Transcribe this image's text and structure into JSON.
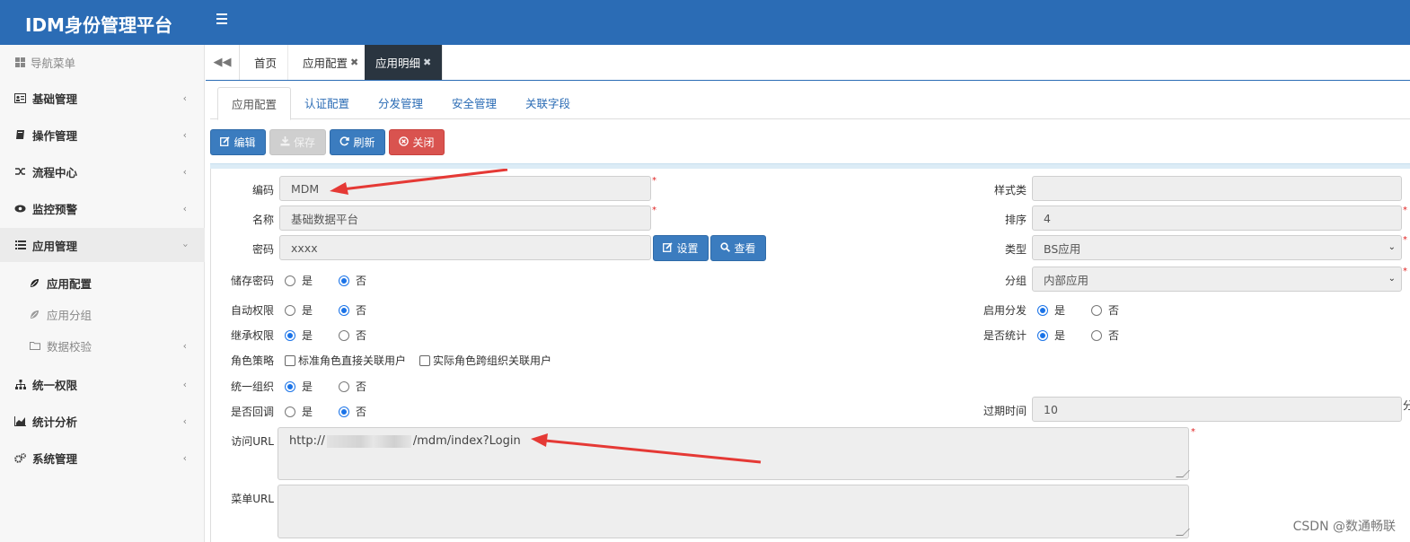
{
  "app": {
    "title": "IDM身份管理平台"
  },
  "sidebar": {
    "header": "导航菜单",
    "items": [
      {
        "label": "基础管理",
        "icon": "id-card-icon"
      },
      {
        "label": "操作管理",
        "icon": "book-icon"
      },
      {
        "label": "流程中心",
        "icon": "shuffle-icon"
      },
      {
        "label": "监控预警",
        "icon": "eye-icon"
      },
      {
        "label": "应用管理",
        "icon": "list-icon"
      },
      {
        "label": "统一权限",
        "icon": "sitemap-icon"
      },
      {
        "label": "统计分析",
        "icon": "area-chart-icon"
      },
      {
        "label": "系统管理",
        "icon": "cogs-icon"
      }
    ],
    "sub_items": [
      {
        "label": "应用配置",
        "icon": "leaf-icon"
      },
      {
        "label": "应用分组",
        "icon": "leaf-icon"
      },
      {
        "label": "数据校验",
        "icon": "folder-icon"
      }
    ]
  },
  "tabs": [
    {
      "label": "首页"
    },
    {
      "label": "应用配置"
    },
    {
      "label": "应用明细"
    }
  ],
  "subtabs": [
    "应用配置",
    "认证配置",
    "分发管理",
    "安全管理",
    "关联字段"
  ],
  "toolbar": {
    "edit": "编辑",
    "save": "保存",
    "refresh": "刷新",
    "close": "关闭"
  },
  "form": {
    "code_label": "编码",
    "code_value": "MDM",
    "name_label": "名称",
    "name_value": "基础数据平台",
    "password_label": "密码",
    "password_value": "xxxx",
    "set_button": "设置",
    "view_button": "查看",
    "store_pwd_label": "储存密码",
    "auto_perm_label": "自动权限",
    "inherit_perm_label": "继承权限",
    "role_policy_label": "角色策略",
    "role_opt1": "标准角色直接关联用户",
    "role_opt2": "实际角色跨组织关联用户",
    "unified_org_label": "统一组织",
    "callback_label": "是否回调",
    "url_label": "访问URL",
    "url_prefix": "http://",
    "url_suffix": "/mdm/index?Login",
    "menu_url_label": "菜单URL",
    "style_label": "样式类",
    "style_value": "",
    "order_label": "排序",
    "order_value": "4",
    "type_label": "类型",
    "type_value": "BS应用",
    "group_label": "分组",
    "group_value": "内部应用",
    "enable_dist_label": "启用分发",
    "stats_label": "是否统计",
    "expire_label": "过期时间",
    "expire_value": "10",
    "expire_unit": "分",
    "yes": "是",
    "no": "否",
    "required_mark": "*",
    "radios": {
      "store_pwd": "no",
      "auto_perm": "no",
      "inherit_perm": "yes",
      "unified_org": "yes",
      "callback": "no",
      "enable_dist": "yes",
      "stats": "yes"
    }
  },
  "watermark": "CSDN @数通畅联",
  "colors": {
    "topbar": "#2b6cb5",
    "primary_button": "#3b7cbf",
    "danger_button": "#d9534f",
    "arrow": "#e53935"
  }
}
